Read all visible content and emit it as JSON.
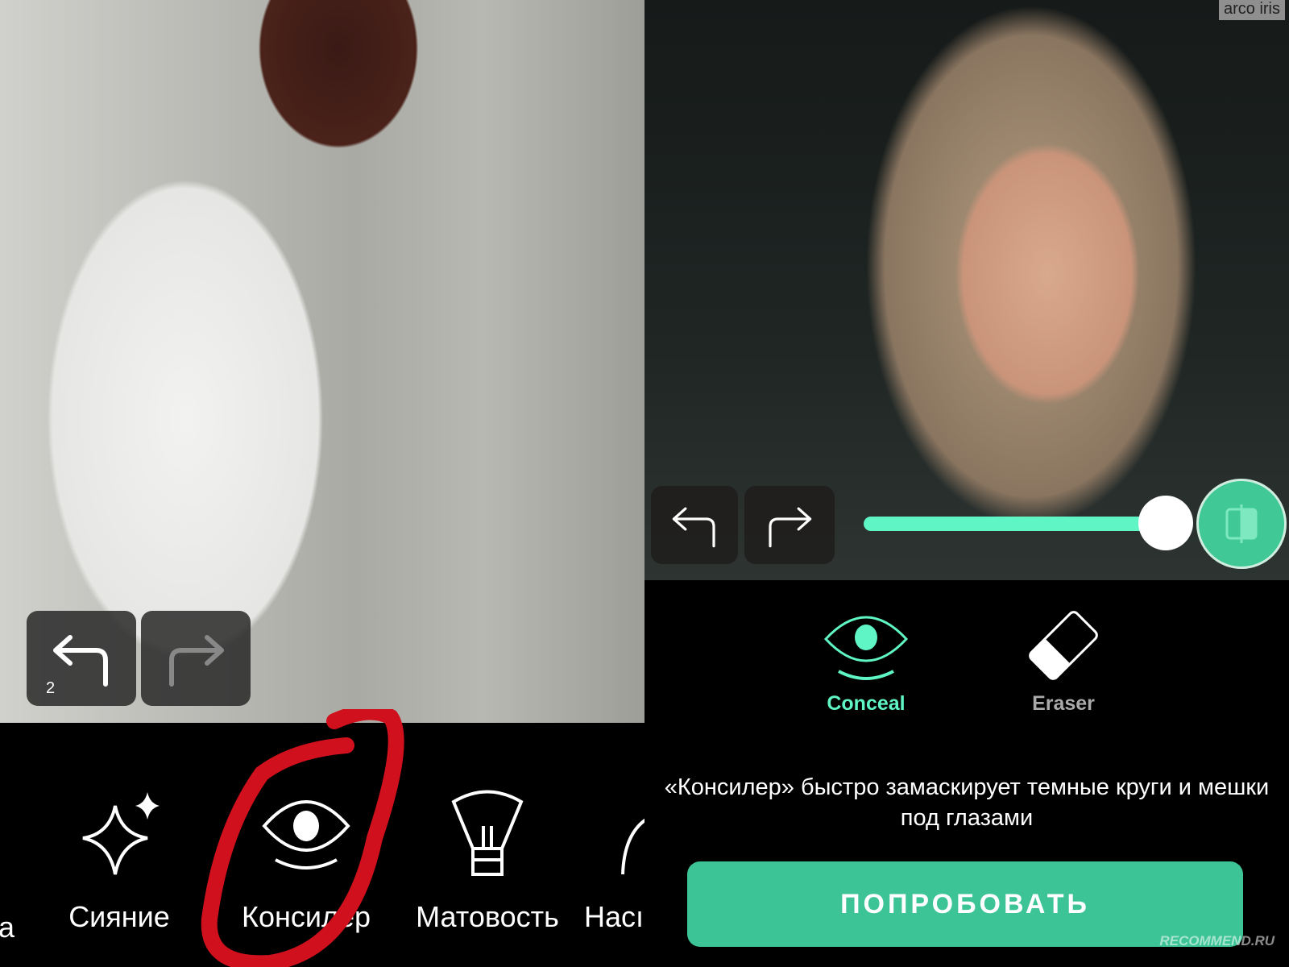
{
  "left": {
    "undo_count": "2",
    "tools": [
      {
        "label": "а",
        "icon": "partial-icon"
      },
      {
        "label": "Сияние",
        "icon": "sparkle-icon"
      },
      {
        "label": "Консилер",
        "icon": "eye-icon",
        "highlighted": true
      },
      {
        "label": "Матовость",
        "icon": "brush-icon"
      },
      {
        "label": "Насı",
        "icon": "partial-arc-icon"
      }
    ],
    "annotation_color": "#d0101c"
  },
  "right": {
    "watermark": "arco iris",
    "slider_value_percent": 100,
    "accent": "#3cc497",
    "modes": [
      {
        "label": "Conceal",
        "active": true
      },
      {
        "label": "Eraser",
        "active": false
      }
    ],
    "description": "«Консилер» быстро замаскирует темные круги и мешки под глазами",
    "try_button": "ПОПРОБОВАТЬ",
    "site_watermark": "RECOMMEND.RU"
  }
}
